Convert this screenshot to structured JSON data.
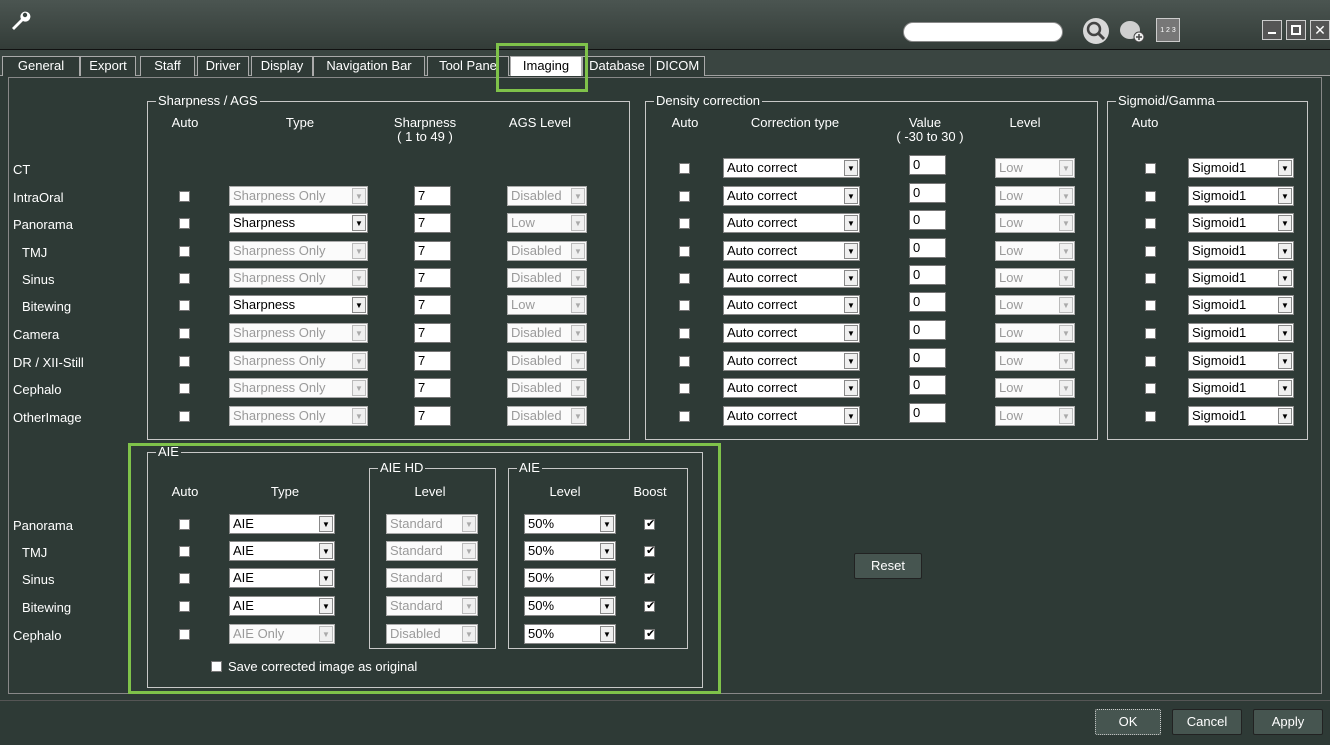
{
  "tabs": [
    {
      "label": "General"
    },
    {
      "label": "Export"
    },
    {
      "label": "Staff"
    },
    {
      "label": "Driver"
    },
    {
      "label": "Display"
    },
    {
      "label": "Navigation Bar"
    },
    {
      "label": "Tool Pane"
    },
    {
      "label": "Imaging"
    },
    {
      "label": "Database"
    },
    {
      "label": "DICOM"
    }
  ],
  "sharpness": {
    "title": "Sharpness / AGS",
    "h_auto": "Auto",
    "h_type": "Type",
    "h_sharp": "Sharpness",
    "h_sharp_range": "( 1 to 49 )",
    "h_ags": "AGS Level"
  },
  "density": {
    "title": "Density correction",
    "h_auto": "Auto",
    "h_type": "Correction type",
    "h_value": "Value",
    "h_value_range": "( -30 to 30 )",
    "h_level": "Level"
  },
  "sigmoid": {
    "title": "Sigmoid/Gamma",
    "h_auto": "Auto"
  },
  "rows": [
    {
      "label": "CT",
      "type": "",
      "sharp": "",
      "ags": "",
      "corr": "Auto correct",
      "value": "0",
      "level": "Low",
      "gamma": "Sigmoid1"
    },
    {
      "label": "IntraOral",
      "type": "Sharpness Only",
      "sharp": "7",
      "ags": "Disabled",
      "corr": "Auto correct",
      "value": "0",
      "level": "Low",
      "gamma": "Sigmoid1"
    },
    {
      "label": "Panorama",
      "type": "Sharpness",
      "sharp": "7",
      "ags": "Low",
      "corr": "Auto correct",
      "value": "0",
      "level": "Low",
      "gamma": "Sigmoid1"
    },
    {
      "label": "TMJ",
      "type": "Sharpness Only",
      "sharp": "7",
      "ags": "Disabled",
      "corr": "Auto correct",
      "value": "0",
      "level": "Low",
      "gamma": "Sigmoid1"
    },
    {
      "label": "Sinus",
      "type": "Sharpness Only",
      "sharp": "7",
      "ags": "Disabled",
      "corr": "Auto correct",
      "value": "0",
      "level": "Low",
      "gamma": "Sigmoid1"
    },
    {
      "label": "Bitewing",
      "type": "Sharpness",
      "sharp": "7",
      "ags": "Low",
      "corr": "Auto correct",
      "value": "0",
      "level": "Low",
      "gamma": "Sigmoid1"
    },
    {
      "label": "Camera",
      "type": "Sharpness Only",
      "sharp": "7",
      "ags": "Disabled",
      "corr": "Auto correct",
      "value": "0",
      "level": "Low",
      "gamma": "Sigmoid1"
    },
    {
      "label": "DR / XII-Still",
      "type": "Sharpness Only",
      "sharp": "7",
      "ags": "Disabled",
      "corr": "Auto correct",
      "value": "0",
      "level": "Low",
      "gamma": "Sigmoid1"
    },
    {
      "label": "Cephalo",
      "type": "Sharpness Only",
      "sharp": "7",
      "ags": "Disabled",
      "corr": "Auto correct",
      "value": "0",
      "level": "Low",
      "gamma": "Sigmoid1"
    },
    {
      "label": "OtherImage",
      "type": "Sharpness Only",
      "sharp": "7",
      "ags": "Disabled",
      "corr": "Auto correct",
      "value": "0",
      "level": "Low",
      "gamma": "Sigmoid1"
    }
  ],
  "aie": {
    "title": "AIE",
    "h_auto": "Auto",
    "h_type": "Type",
    "hd_title": "AIE HD",
    "hd_level": "Level",
    "aie2_title": "AIE",
    "aie2_level": "Level",
    "aie2_boost": "Boost",
    "save_label": "Save corrected image as original",
    "rows": [
      {
        "label": "Panorama",
        "type": "AIE",
        "hd": "Standard",
        "level": "50%"
      },
      {
        "label": "TMJ",
        "type": "AIE",
        "hd": "Standard",
        "level": "50%"
      },
      {
        "label": "Sinus",
        "type": "AIE",
        "hd": "Standard",
        "level": "50%"
      },
      {
        "label": "Bitewing",
        "type": "AIE",
        "hd": "Standard",
        "level": "50%"
      },
      {
        "label": "Cephalo",
        "type": "AIE Only",
        "hd": "Disabled",
        "level": "50%"
      }
    ]
  },
  "reset_label": "Reset",
  "footer": {
    "ok": "OK",
    "cancel": "Cancel",
    "apply": "Apply"
  },
  "titlebar": {
    "search_placeholder": "",
    "grid_icon_text": "1 2 3"
  },
  "colors": {
    "highlight": "#7fc24a",
    "background": "#2e3a36"
  }
}
